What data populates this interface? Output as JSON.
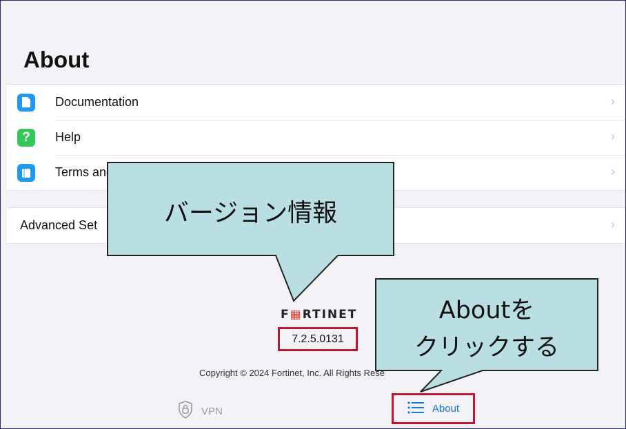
{
  "page": {
    "title": "About"
  },
  "list": {
    "items": [
      {
        "label": "Documentation",
        "icon": "document-icon",
        "color": "#1e9bf0"
      },
      {
        "label": "Help",
        "icon": "question-icon",
        "color": "#34c759"
      },
      {
        "label": "Terms and",
        "icon": "book-icon",
        "color": "#1e9bf0"
      }
    ],
    "advanced_label": "Advanced Set"
  },
  "footer": {
    "logo": "FORTINET",
    "version": "7.2.5.0131",
    "copyright": "Copyright © 2024 Fortinet, Inc. All Rights Rese"
  },
  "tabbar": {
    "vpn_label": "VPN",
    "about_label": "About"
  },
  "callouts": {
    "version_info": "バージョン情報",
    "click_about_line1": "Aboutを",
    "click_about_line2": "クリックする"
  },
  "colors": {
    "accent": "#1a73e8",
    "highlight_border": "#c0142f",
    "callout_fill": "#b9dfe3"
  }
}
